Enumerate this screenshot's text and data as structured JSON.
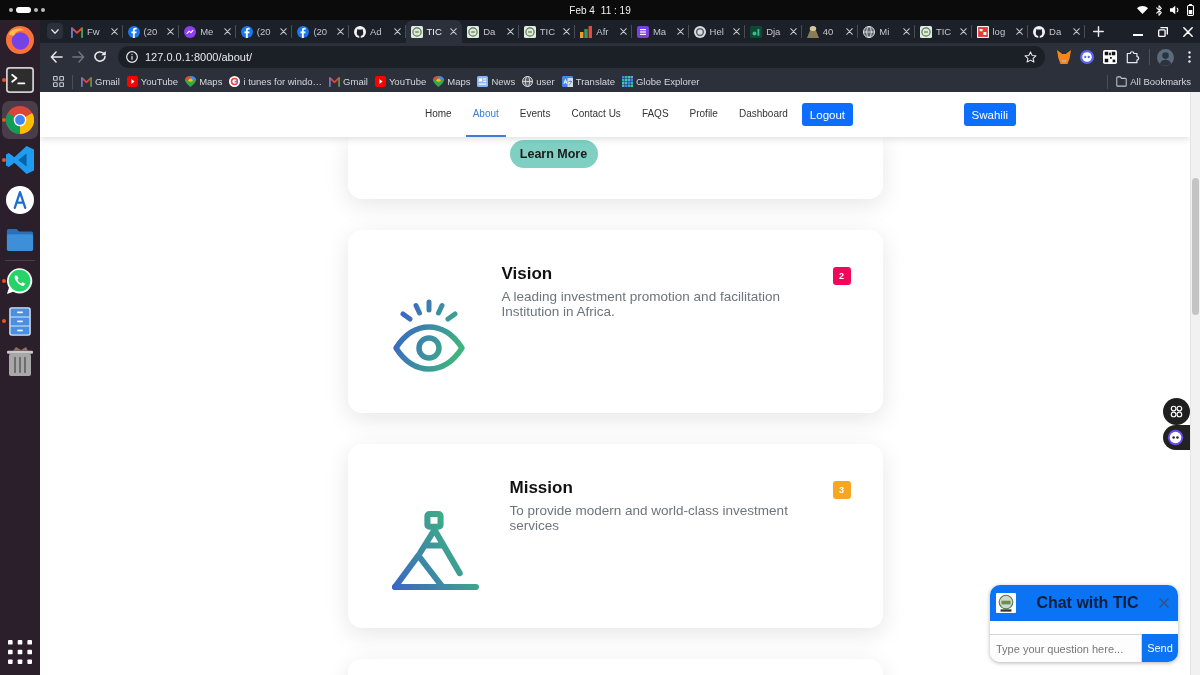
{
  "system_bar": {
    "date": "Feb 4",
    "time": "11 : 19"
  },
  "dock": {
    "pinned": [
      {
        "kind": "firefox",
        "running": false,
        "selected": false
      },
      {
        "kind": "terminal",
        "running": true,
        "selected": false
      },
      {
        "kind": "chrome",
        "running": true,
        "selected": true
      },
      {
        "kind": "code",
        "running": true,
        "selected": false
      },
      {
        "kind": "store",
        "running": false,
        "selected": false
      },
      {
        "kind": "files",
        "running": false,
        "selected": false
      }
    ],
    "open": [
      {
        "kind": "whatsapp",
        "running": true,
        "selected": false
      },
      {
        "kind": "cabinet",
        "running": true,
        "selected": false
      },
      {
        "kind": "trash",
        "running": false,
        "selected": false
      }
    ]
  },
  "browser": {
    "tabs": [
      {
        "title": "Fw",
        "kind": "gmail",
        "selected": false
      },
      {
        "title": "(20",
        "kind": "facebook",
        "selected": false
      },
      {
        "title": "Me",
        "kind": "messenger",
        "selected": false
      },
      {
        "title": "(20",
        "kind": "facebook",
        "selected": false
      },
      {
        "title": "(20",
        "kind": "facebook",
        "selected": false
      },
      {
        "title": "Ad",
        "kind": "github",
        "selected": false
      },
      {
        "title": "TIC",
        "kind": "emblem",
        "selected": true
      },
      {
        "title": "Da",
        "kind": "emblem",
        "selected": false
      },
      {
        "title": "TIC",
        "kind": "emblem",
        "selected": false
      },
      {
        "title": "Afr",
        "kind": "chart",
        "selected": false
      },
      {
        "title": "Ma",
        "kind": "list",
        "selected": false
      },
      {
        "title": "Hel",
        "kind": "circle",
        "selected": false
      },
      {
        "title": "Dja",
        "kind": "dj",
        "selected": false
      },
      {
        "title": "40",
        "kind": "figure",
        "selected": false
      },
      {
        "title": "Mi",
        "kind": "globe",
        "selected": false
      },
      {
        "title": "TIC",
        "kind": "emblem",
        "selected": false
      },
      {
        "title": "log",
        "kind": "image",
        "selected": false
      },
      {
        "title": "Da",
        "kind": "github",
        "selected": false
      }
    ],
    "toolbar": {
      "buttons": [
        {
          "kind": "back",
          "disabled": false
        },
        {
          "kind": "forward",
          "disabled": true
        },
        {
          "kind": "reload",
          "disabled": false
        }
      ],
      "url": "127.0.0.1:8000/about/"
    },
    "bookmarks": [
      {
        "label": "Gmail",
        "kind": "gmail"
      },
      {
        "label": "YouTube",
        "kind": "youtube"
      },
      {
        "label": "Maps",
        "kind": "maps"
      },
      {
        "label": "i tunes for windo…",
        "kind": "google"
      },
      {
        "label": "Gmail",
        "kind": "gmail"
      },
      {
        "label": "YouTube",
        "kind": "youtube"
      },
      {
        "label": "Maps",
        "kind": "maps"
      },
      {
        "label": "News",
        "kind": "news"
      },
      {
        "label": "user",
        "kind": "globe"
      },
      {
        "label": "Translate",
        "kind": "translate"
      },
      {
        "label": "Globe Explorer",
        "kind": "tiles"
      }
    ],
    "all_bookmarks": "All Bookmarks"
  },
  "page": {
    "nav": {
      "items": [
        {
          "label": "Home",
          "selected": false
        },
        {
          "label": "About",
          "selected": true
        },
        {
          "label": "Events",
          "selected": false
        },
        {
          "label": "Contact Us",
          "selected": false
        },
        {
          "label": "FAQS",
          "selected": false
        },
        {
          "label": "Profile",
          "selected": false
        },
        {
          "label": "Dashboard",
          "selected": false
        }
      ],
      "logout": "Logout",
      "language": "Swahili"
    },
    "cards": [
      {
        "kind": "cta",
        "button": "Learn More"
      },
      {
        "kind": "eye",
        "title": "Vision",
        "text": "A leading investment promotion and facilitation Institution in Africa.",
        "badge": "2",
        "color": "#f0085a"
      },
      {
        "kind": "mountain",
        "title": "Mission",
        "text": "To provide modern and world-class investment services",
        "badge": "3",
        "color": "#f5a623"
      },
      {
        "kind": "blank"
      }
    ],
    "chat": {
      "title": "Chat with TIC",
      "placeholder": "Type your question here...",
      "send": "Send"
    }
  }
}
